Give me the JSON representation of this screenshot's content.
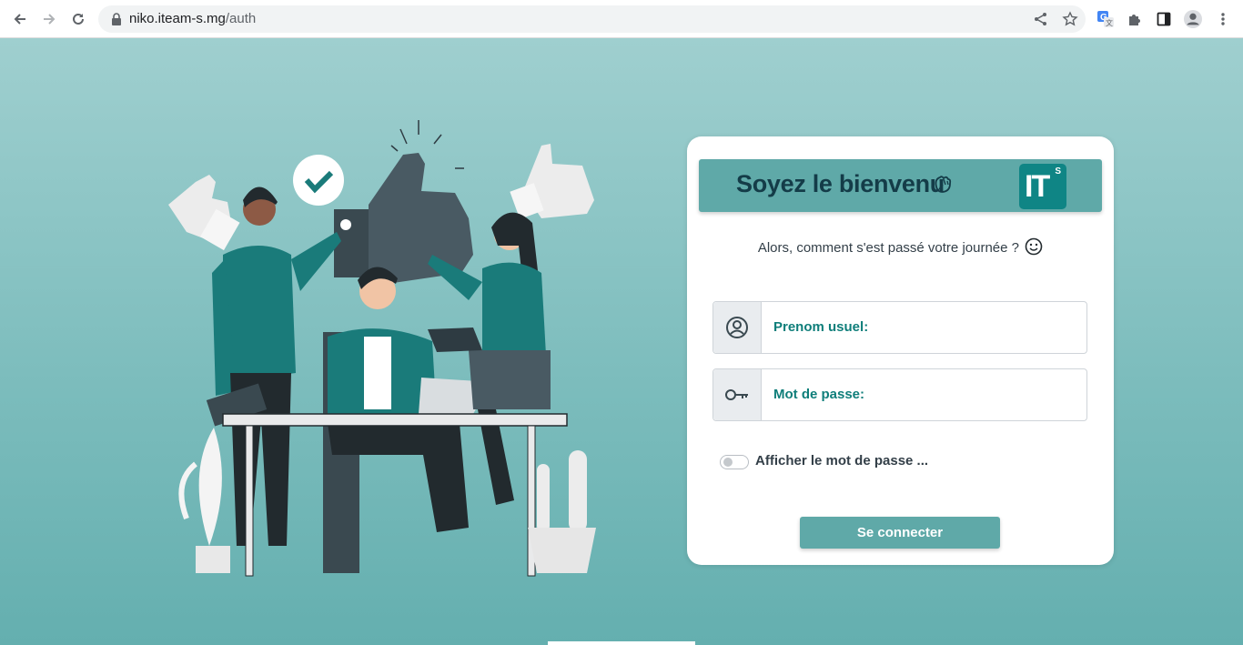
{
  "browser": {
    "url_host": "niko.iteam-s.mg",
    "url_path": "/auth"
  },
  "login": {
    "banner_title": "Soyez le bienvenu",
    "logo_text": "IT",
    "logo_superscript": "S",
    "subtitle": "Alors, comment s'est passé votre journée ?",
    "username_label": "Prenom usuel:",
    "password_label": "Mot de passe:",
    "show_password_label": "Afficher le mot de passe ...",
    "submit_label": "Se connecter"
  },
  "icons": {
    "username": "user-circle-icon",
    "password": "key-icon",
    "greeting": "waving-hand-icon",
    "mood": "smiley-icon"
  },
  "colors": {
    "accent": "#5fa9a8",
    "label_teal": "#0f7e7a",
    "logo_bg": "#0f8585",
    "title_dark": "#143c48"
  }
}
